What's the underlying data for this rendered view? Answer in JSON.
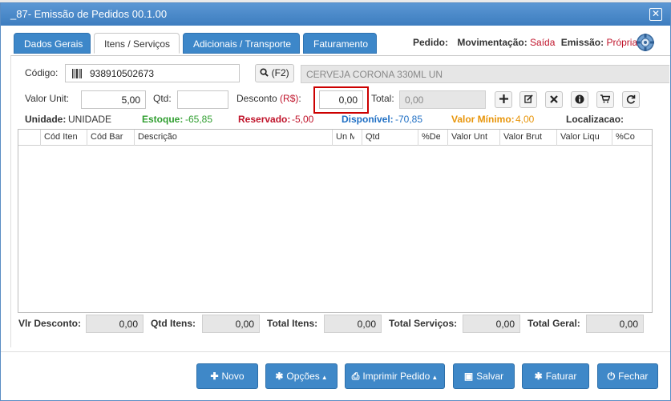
{
  "window": {
    "title": "_87- Emissão de Pedidos 00.1.00",
    "close_glyph": "✕"
  },
  "tabs": [
    {
      "label": "Dados Gerais"
    },
    {
      "label": "Itens / Serviços"
    },
    {
      "label": "Adicionais / Transporte"
    },
    {
      "label": "Faturamento"
    }
  ],
  "pedido": {
    "label": "Pedido:",
    "movimentacao_label": "Movimentação:",
    "movimentacao_value": "Saída",
    "emissao_label": "Emissão:",
    "emissao_value": "Própria"
  },
  "form": {
    "codigo_label": "Código:",
    "codigo_value": "938910502673",
    "search_label": "(F2)",
    "descricao_value": "CERVEJA CORONA 330ML UN",
    "valor_unit_label": "Valor Unit:",
    "valor_unit_value": "5,00",
    "qtd_label": "Qtd:",
    "qtd_value": "",
    "desconto_label": "Desconto",
    "desconto_currency": "(R$)",
    "desconto_colon": ":",
    "desconto_value": "0,00",
    "total_label": "Total:",
    "total_value": "0,00"
  },
  "status": {
    "unidade_label": "Unidade:",
    "unidade_value": "UNIDADE",
    "estoque_label": "Estoque:",
    "estoque_value": "-65,85",
    "reservado_label": "Reservado:",
    "reservado_value": "-5,00",
    "disponivel_label": "Disponível:",
    "disponivel_value": "-70,85",
    "valor_minimo_label": "Valor Mínimo:",
    "valor_minimo_value": "4,00",
    "localizacao_label": "Localizacao:"
  },
  "grid": {
    "columns": [
      "Cód Iten",
      "Cód Bar",
      "Descrição",
      "Un M",
      "Qtd",
      "%De",
      "Valor Unt",
      "Valor Brut",
      "Valor Liqu",
      "%Co"
    ]
  },
  "totals": {
    "vlr_desconto_label": "Vlr Desconto:",
    "vlr_desconto_value": "0,00",
    "qtd_itens_label": "Qtd Itens:",
    "qtd_itens_value": "0,00",
    "total_itens_label": "Total Itens:",
    "total_itens_value": "0,00",
    "total_servicos_label": "Total Serviços:",
    "total_servicos_value": "0,00",
    "total_geral_label": "Total Geral:",
    "total_geral_value": "0,00"
  },
  "buttons": {
    "novo": "Novo",
    "opcoes": "Opções",
    "imprimir": "Imprimir Pedido",
    "salvar": "Salvar",
    "faturar": "Faturar",
    "fechar": "Fechar"
  },
  "colors": {
    "primary": "#3f88c8",
    "red": "#c0142b",
    "green": "#2f9e2f",
    "blue": "#1f6fc4",
    "orange": "#e8950a",
    "highlight_border": "#cc0000"
  }
}
